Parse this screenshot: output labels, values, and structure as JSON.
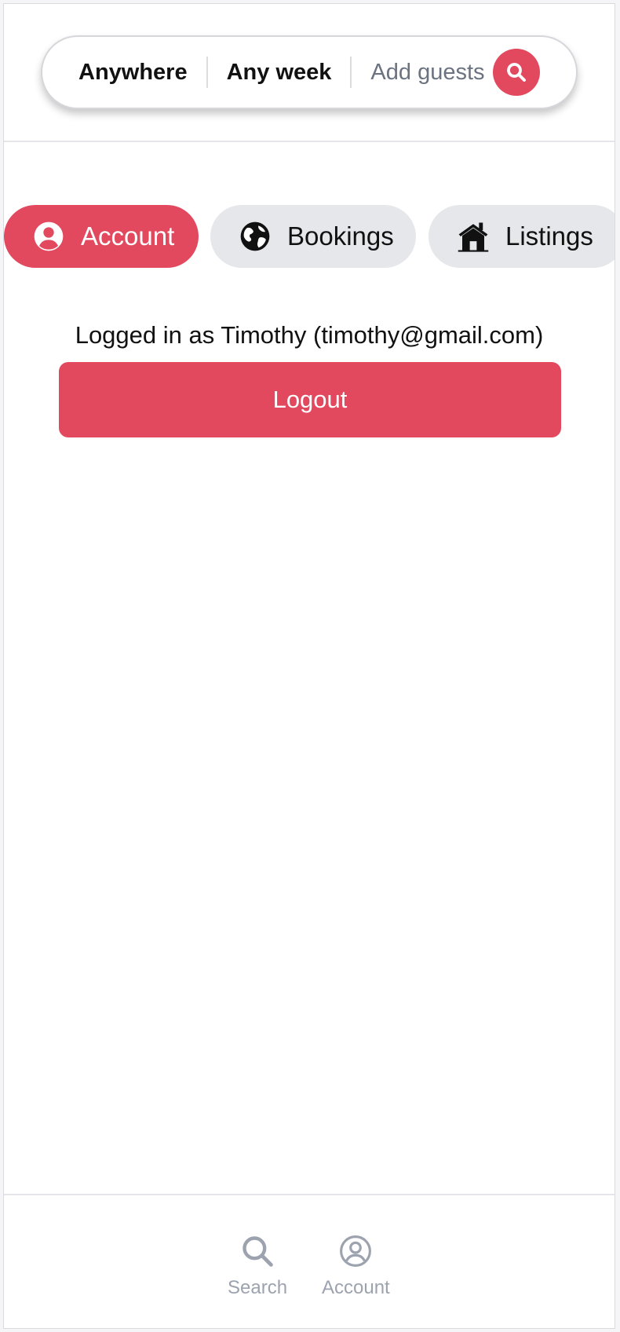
{
  "colors": {
    "accent": "#e2495f",
    "tab_inactive_bg": "#e5e7eb",
    "muted_text": "#6b7280",
    "footer_gray": "#9ca3af"
  },
  "search_bar": {
    "location": "Anywhere",
    "dates": "Any week",
    "guests_placeholder": "Add guests",
    "search_icon": "search-icon"
  },
  "tabs": [
    {
      "label": "Account",
      "icon": "user-circle-icon",
      "active": true
    },
    {
      "label": "Bookings",
      "icon": "globe-icon",
      "active": false
    },
    {
      "label": "Listings",
      "icon": "home-icon",
      "active": false
    }
  ],
  "account": {
    "status_text": "Logged in as Timothy (timothy@gmail.com)",
    "logout_label": "Logout"
  },
  "footer_nav": [
    {
      "label": "Search",
      "icon": "search-icon"
    },
    {
      "label": "Account",
      "icon": "user-circle-icon"
    }
  ]
}
